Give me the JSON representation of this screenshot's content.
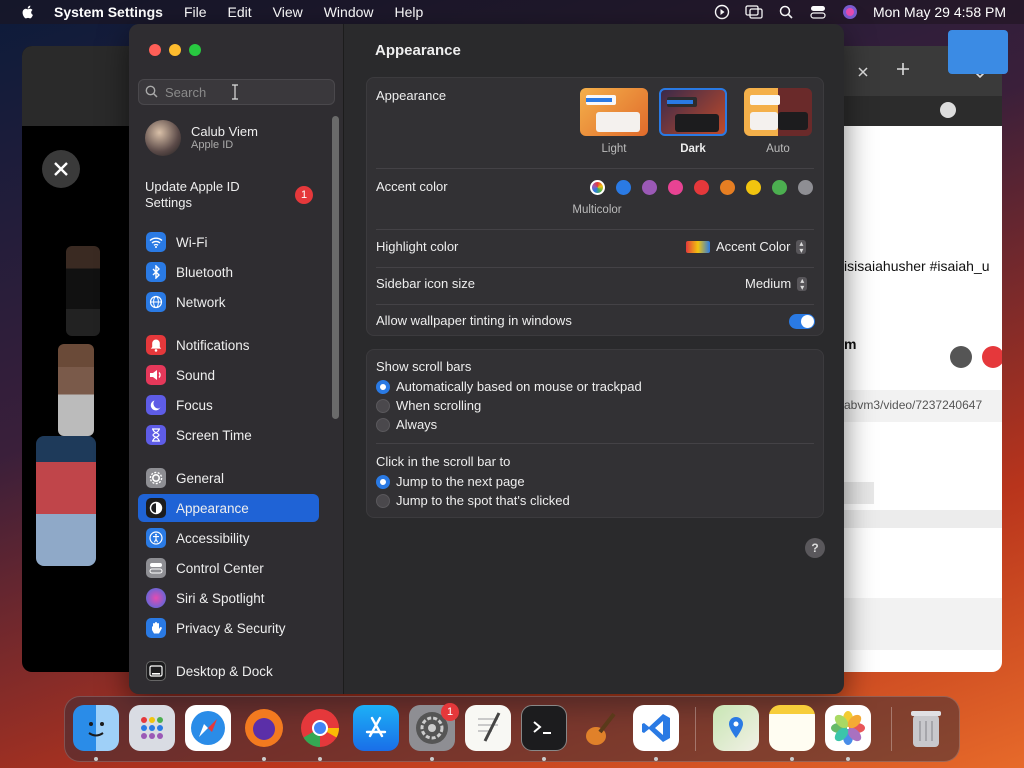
{
  "menubar": {
    "app_name": "System Settings",
    "items": [
      "File",
      "Edit",
      "View",
      "Window",
      "Help"
    ],
    "datetime": "Mon May 29  4:58 PM"
  },
  "browser_window": {
    "line1": "isisaiahusher #isaiah_u",
    "line2": "m",
    "url": "abvm3/video/7237240647"
  },
  "sidebar": {
    "search_placeholder": "Search",
    "user_name": "Calub Viem",
    "user_sub": "Apple ID",
    "update_text": "Update Apple ID Settings",
    "update_badge": "1",
    "items": [
      {
        "label": "Wi-Fi",
        "icon": "wifi-icon",
        "color": "#2a7ae4"
      },
      {
        "label": "Bluetooth",
        "icon": "bluetooth-icon",
        "color": "#2a7ae4"
      },
      {
        "label": "Network",
        "icon": "globe-icon",
        "color": "#2a7ae4"
      },
      {
        "label": "Notifications",
        "icon": "bell-icon",
        "color": "#e5383b"
      },
      {
        "label": "Sound",
        "icon": "speaker-icon",
        "color": "#e5385a"
      },
      {
        "label": "Focus",
        "icon": "moon-icon",
        "color": "#5e5ce6"
      },
      {
        "label": "Screen Time",
        "icon": "hourglass-icon",
        "color": "#5e5ce6"
      },
      {
        "label": "General",
        "icon": "gear-icon",
        "color": "#8e8e93"
      },
      {
        "label": "Appearance",
        "icon": "appearance-icon",
        "color": "#1c1c1e"
      },
      {
        "label": "Accessibility",
        "icon": "accessibility-icon",
        "color": "#2a7ae4"
      },
      {
        "label": "Control Center",
        "icon": "control-center-icon",
        "color": "#8e8e93"
      },
      {
        "label": "Siri & Spotlight",
        "icon": "siri-icon",
        "color": "#c04fc8"
      },
      {
        "label": "Privacy & Security",
        "icon": "hand-icon",
        "color": "#2a7ae4"
      },
      {
        "label": "Desktop & Dock",
        "icon": "dock-icon",
        "color": "#1c1c1e"
      }
    ],
    "selected": "Appearance"
  },
  "main": {
    "title": "Appearance",
    "appearance_label": "Appearance",
    "appearance_options": [
      "Light",
      "Dark",
      "Auto"
    ],
    "appearance_selected": "Dark",
    "accent_label": "Accent color",
    "accent_selected_name": "Multicolor",
    "accent_colors": [
      "#2a7ae4",
      "#9b59b6",
      "#e84393",
      "#e5383b",
      "#e67e22",
      "#f1c40f",
      "#4caf50",
      "#8e8e93"
    ],
    "highlight_label": "Highlight color",
    "highlight_value": "Accent Color",
    "sidebar_icon_label": "Sidebar icon size",
    "sidebar_icon_value": "Medium",
    "tinting_label": "Allow wallpaper tinting in windows",
    "tinting_on": true,
    "scroll_bars_label": "Show scroll bars",
    "scroll_bars_options": [
      "Automatically based on mouse or trackpad",
      "When scrolling",
      "Always"
    ],
    "scroll_bars_selected": 0,
    "click_label": "Click in the scroll bar to",
    "click_options": [
      "Jump to the next page",
      "Jump to the spot that's clicked"
    ],
    "click_selected": 0,
    "help": "?"
  },
  "dock": {
    "apps": [
      "Finder",
      "Launchpad",
      "Safari",
      "Firefox",
      "Chrome",
      "App Store",
      "System Settings",
      "TextEdit",
      "Terminal",
      "GarageBand",
      "Visual Studio Code",
      "Maps",
      "Notes",
      "Photos",
      "Trash"
    ],
    "settings_badge": "1"
  }
}
